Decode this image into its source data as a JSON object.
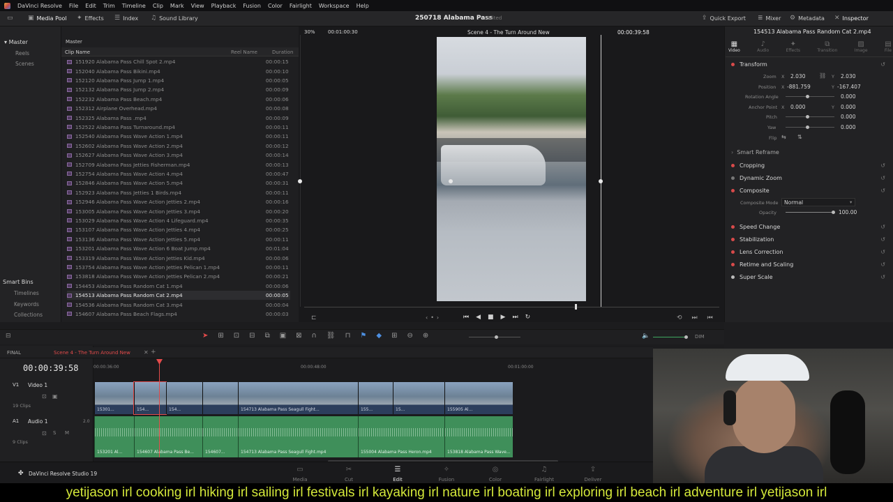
{
  "menubar": {
    "app_name": "DaVinci Resolve",
    "items": [
      "File",
      "Edit",
      "Trim",
      "Timeline",
      "Clip",
      "Mark",
      "View",
      "Playback",
      "Fusion",
      "Color",
      "Fairlight",
      "Workspace",
      "Help"
    ]
  },
  "toolbar": {
    "media_pool": "Media Pool",
    "effects": "Effects",
    "index": "Index",
    "sound_library": "Sound Library",
    "project_title": "250718 Alabama Pass",
    "project_state": "Edited",
    "quick_export": "Quick Export",
    "mixer": "Mixer",
    "metadata": "Metadata",
    "inspector": "Inspector"
  },
  "bins": {
    "master": "Master",
    "items": [
      "Reels",
      "Scenes"
    ],
    "smart_bins": "Smart Bins",
    "smart_items": [
      "Timelines",
      "Keywords",
      "Collections"
    ]
  },
  "pool": {
    "path": "Master",
    "col_clip_name": "Clip Name",
    "col_reel_name": "Reel Name",
    "col_duration": "Duration",
    "clips": [
      {
        "name": "151920 Alabama Pass Chill Spot 2.mp4",
        "dur": "00:00:15"
      },
      {
        "name": "152040 Alabama Pass Bikini.mp4",
        "dur": "00:00:10"
      },
      {
        "name": "152120 Alabama Pass Jump 1.mp4",
        "dur": "00:00:05"
      },
      {
        "name": "152132 Alabama Pass Jump 2.mp4",
        "dur": "00:00:09"
      },
      {
        "name": "152232 Alabama Pass Beach.mp4",
        "dur": "00:00:06"
      },
      {
        "name": "152312 Airplane Overhead.mp4",
        "dur": "00:00:08"
      },
      {
        "name": "152325 Alabama Pass .mp4",
        "dur": "00:00:09"
      },
      {
        "name": "152522 Alabama Pass Turnaround.mp4",
        "dur": "00:00:11"
      },
      {
        "name": "152540 Alabama Pass Wave Action 1.mp4",
        "dur": "00:00:11"
      },
      {
        "name": "152602 Alabama Pass Wave Action 2.mp4",
        "dur": "00:00:12"
      },
      {
        "name": "152627 Alabama Pass Wave Action 3.mp4",
        "dur": "00:00:14"
      },
      {
        "name": "152709 Alabama Pass Jetties Fisherman.mp4",
        "dur": "00:00:13"
      },
      {
        "name": "152754 Alabama Pass Wave Action 4.mp4",
        "dur": "00:00:47"
      },
      {
        "name": "152846 Alabama Pass Wave Action 5.mp4",
        "dur": "00:00:31"
      },
      {
        "name": "152923 Alabama Pass Jetties 1 Birds.mp4",
        "dur": "00:00:11"
      },
      {
        "name": "152946 Alabama Pass Wave Action Jetties 2.mp4",
        "dur": "00:00:16"
      },
      {
        "name": "153005 Alabama Pass Wave Action Jetties 3.mp4",
        "dur": "00:00:20"
      },
      {
        "name": "153029 Alabama Pass Wave Action 4 Lifeguard.mp4",
        "dur": "00:00:35"
      },
      {
        "name": "153107 Alabama Pass Wave Action Jetties 4.mp4",
        "dur": "00:00:25"
      },
      {
        "name": "153136 Alabama Pass  Wave Action Jetties 5.mp4",
        "dur": "00:00:11"
      },
      {
        "name": "153201 Alabama Pass Wave Action 6 Boat Jump.mp4",
        "dur": "00:01:04"
      },
      {
        "name": "153319 Alabama Pass  Wave Action Jetties Kid.mp4",
        "dur": "00:00:06"
      },
      {
        "name": "153754 Alabama Pass  Wave Action Jetties Pelican 1.mp4",
        "dur": "00:00:11"
      },
      {
        "name": "153818 Alabama Pass  Wave Action Jetties Pelican 2.mp4",
        "dur": "00:00:21"
      },
      {
        "name": "154453 Alabama Pass  Random Cat 1.mp4",
        "dur": "00:00:06"
      },
      {
        "name": "154513 Alabama Pass Random Cat 2.mp4",
        "dur": "00:00:05"
      },
      {
        "name": "154536 Alabama Pass Random Cat 3.mp4",
        "dur": "00:00:04"
      },
      {
        "name": "154607 Alabama Pass Beach Flags.mp4",
        "dur": "00:00:03"
      }
    ]
  },
  "viewer": {
    "zoom": "30%",
    "source_tc": "00:01:00:30",
    "timeline_name": "Scene 4 - The Turn Around New",
    "record_tc": "00:00:39:58"
  },
  "inspector": {
    "clip_title": "154513 Alabama Pass Random Cat 2.mp4",
    "tabs": [
      "Video",
      "Audio",
      "Effects",
      "Transition",
      "Image",
      "File"
    ],
    "sections": {
      "transform": "Transform",
      "smart_reframe": "Smart Reframe",
      "cropping": "Cropping",
      "dynamic_zoom": "Dynamic Zoom",
      "composite": "Composite",
      "speed_change": "Speed Change",
      "stabilization": "Stabilization",
      "lens_correction": "Lens Correction",
      "retime_scaling": "Retime and Scaling",
      "super_scale": "Super Scale"
    },
    "params": {
      "zoom_label": "Zoom",
      "zoom_x": "2.030",
      "zoom_y": "2.030",
      "position_label": "Position",
      "position_x": "-881.759",
      "position_y": "-167.407",
      "rotation_label": "Rotation Angle",
      "rotation": "0.000",
      "anchor_label": "Anchor Point",
      "anchor_x": "0.000",
      "anchor_y": "0.000",
      "pitch_label": "Pitch",
      "pitch": "0.000",
      "yaw_label": "Yaw",
      "yaw": "0.000",
      "flip_label": "Flip",
      "composite_mode_label": "Composite Mode",
      "composite_mode": "Normal",
      "opacity_label": "Opacity",
      "opacity": "100.00",
      "x": "X",
      "y": "Y"
    }
  },
  "timeline": {
    "name": "FINAL",
    "tab": "Scene 4 - The Turn Around New",
    "timecode": "00:00:39:58",
    "ruler": [
      "00:00:36:00",
      "00:00:48:00",
      "00:01:00:00"
    ],
    "video_track": {
      "id": "V1",
      "name": "Video 1",
      "count": "19 Clips"
    },
    "audio_track": {
      "id": "A1",
      "name": "Audio 1",
      "level": "2.0",
      "count": "9 Clips"
    },
    "video_clips": [
      "15301...",
      "154...",
      "154...",
      "",
      "154713 Alabama Pass Seagull Fight...",
      "155...",
      "15...",
      "155905 Al..."
    ],
    "audio_clips": [
      "153201 Al...",
      "154607 Alabama Pass Be...",
      "154607...",
      "154713 Alabama Pass Seagull Fight.mp4",
      "155004 Alabama Pass Heron.mp4",
      "153818 Alabama Pass  Wave..."
    ]
  },
  "volume": {
    "dim": "DIM"
  },
  "pagenav": {
    "brand": "DaVinci Resolve Studio 19",
    "pages": [
      "Media",
      "Cut",
      "Edit",
      "Fusion",
      "Color",
      "Fairlight",
      "Deliver"
    ],
    "active": "Edit"
  },
  "banner": {
    "text": "yetijason irl cooking irl hiking irl sailing irl festivals irl kayaking irl nature irl boating irl exploring irl beach irl adventure irl yetijason irl"
  },
  "colors": {
    "accent": "#d84a4a",
    "timeline_audio": "#3f8f5a",
    "banner_text": "#d4e83a",
    "playhead": "#e34b4b"
  }
}
